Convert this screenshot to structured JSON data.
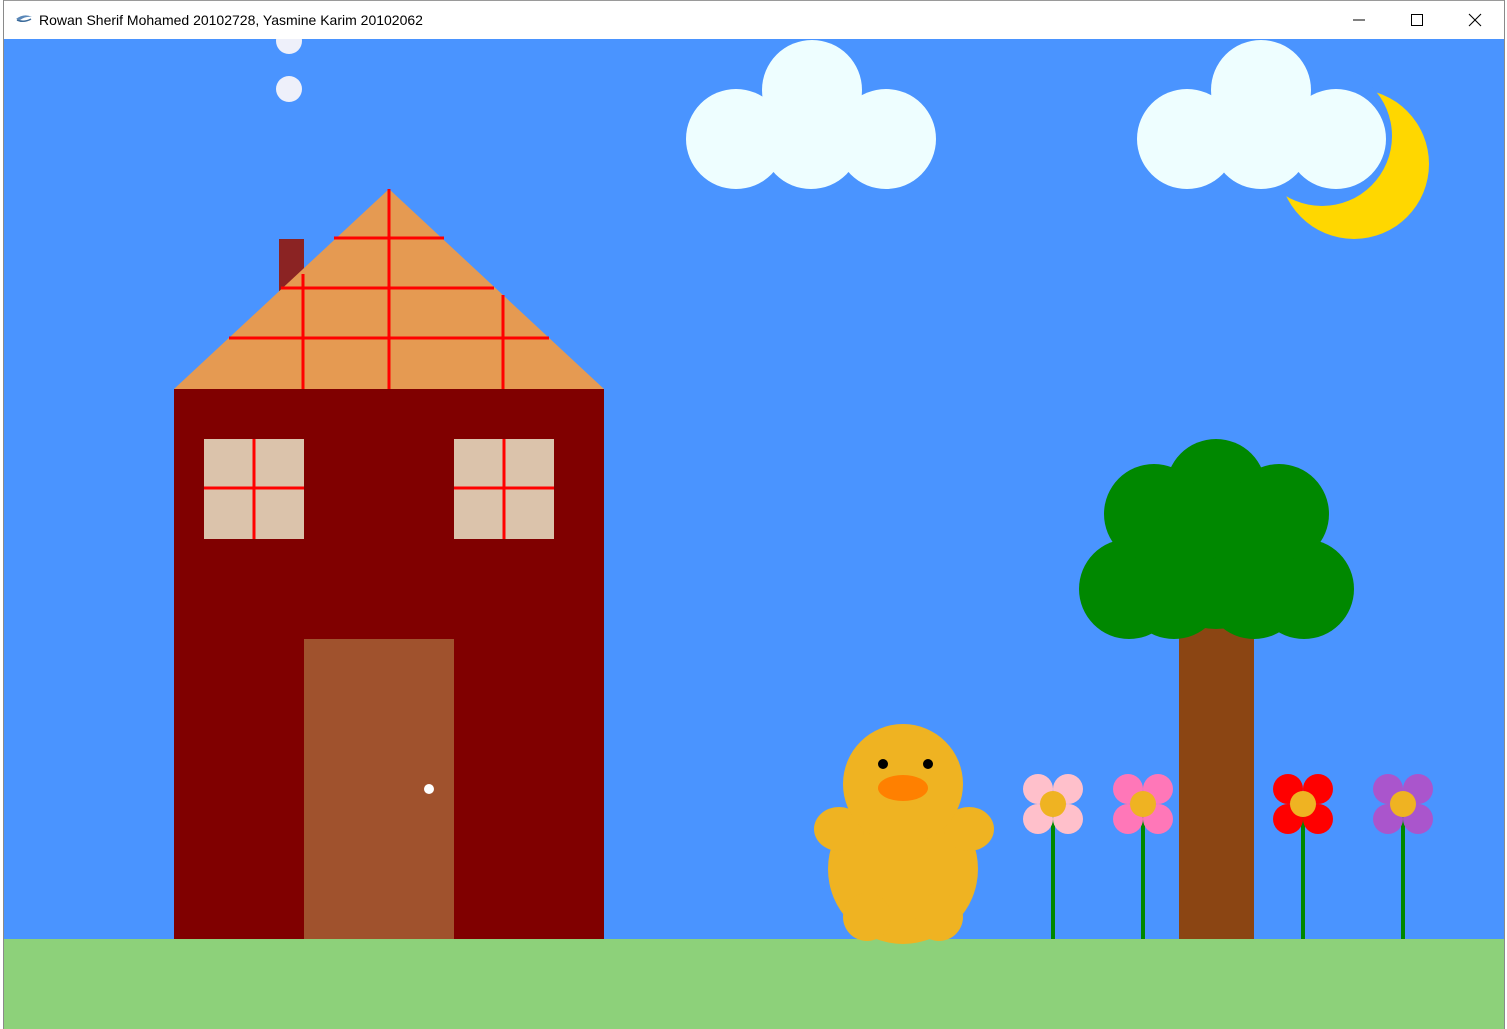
{
  "window": {
    "title": "Rowan Sherif Mohamed 20102728, Yasmine Karim 20102062",
    "app_icon": "java-cup-icon",
    "controls": [
      "minimize-icon",
      "maximize-icon",
      "close-icon"
    ]
  },
  "scene": {
    "colors": {
      "sky": "#4a94ff",
      "grass": "#8dd17a",
      "house_wall": "#800000",
      "roof": "#e59a52",
      "roof_lines": "#ff0000",
      "chimney": "#8b2323",
      "smoke": "#eef0fa",
      "window_glass": "#dbc3ab",
      "window_frame": "#ff0000",
      "door": "#a0522d",
      "doorknob": "#ffffff",
      "cloud": "#eefeff",
      "moon": "#ffd700",
      "tree_leaves": "#008800",
      "tree_trunk": "#8b4513",
      "duck_body": "#efb322",
      "duck_beak": "#ff8000",
      "duck_eyes": "#000000",
      "flower_stem": "#008800",
      "flower_center": "#efb322",
      "flower_petals": [
        "#ffc0cb",
        "#ff77b8",
        "#ff0000",
        "#aa55cc"
      ]
    }
  }
}
